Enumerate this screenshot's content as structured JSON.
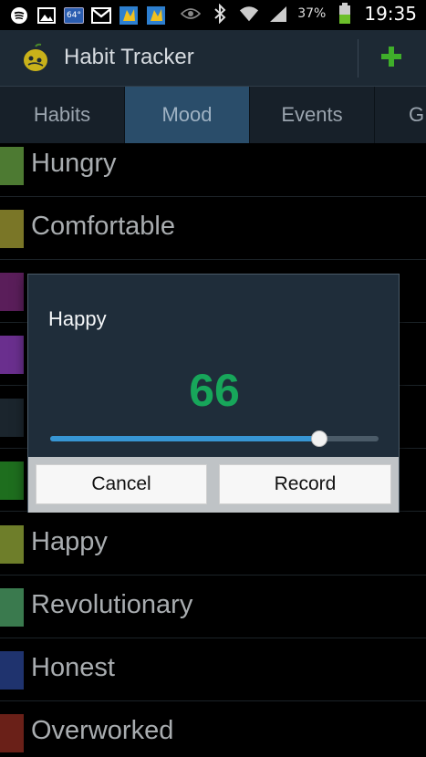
{
  "status_bar": {
    "temperature": "64°",
    "battery_percent": "37%",
    "time": "19:35",
    "icons": [
      "spotify-icon",
      "image-icon",
      "weather-icon",
      "gmail-icon",
      "game-icon",
      "game-icon",
      "eye-icon",
      "bluetooth-icon",
      "wifi-icon",
      "signal-icon",
      "battery-icon"
    ]
  },
  "action_bar": {
    "title": "Habit Tracker",
    "add_icon": "plus-icon",
    "accent": "#3fae2a"
  },
  "tabs": [
    {
      "label": "Habits",
      "active": false
    },
    {
      "label": "Mood",
      "active": true
    },
    {
      "label": "Events",
      "active": false
    },
    {
      "label": "G",
      "active": false
    }
  ],
  "list": [
    {
      "label": "Hungry",
      "color": "#4d7a32"
    },
    {
      "label": "Comfortable",
      "color": "#7a7627"
    },
    {
      "label": "",
      "color": "#5a1e5a"
    },
    {
      "label": "",
      "color": "#6a2f8e"
    },
    {
      "label": "",
      "color": "#1b252d"
    },
    {
      "label": "",
      "color": "#1e6e1e"
    },
    {
      "label": "Happy",
      "color": "#6e7e2a"
    },
    {
      "label": "Revolutionary",
      "color": "#3a7a4e"
    },
    {
      "label": "Honest",
      "color": "#1f336e"
    },
    {
      "label": "Overworked",
      "color": "#6a2018"
    }
  ],
  "dialog": {
    "title": "Happy",
    "value": "66",
    "slider_value": 66,
    "slider_max": 100,
    "value_color": "#17a65a",
    "cancel_label": "Cancel",
    "record_label": "Record"
  }
}
